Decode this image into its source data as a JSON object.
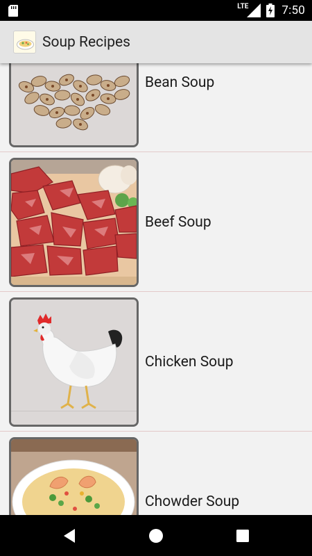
{
  "status_bar": {
    "time": "7:50",
    "network": "LTE",
    "icons": [
      "sd-card-icon",
      "signal-icon",
      "battery-charging-icon"
    ]
  },
  "app_bar": {
    "title": "Soup Recipes",
    "logo_icon": "soup-bowl-icon"
  },
  "recipes": [
    {
      "label": "Bean Soup",
      "image": "beans-image"
    },
    {
      "label": "Beef Soup",
      "image": "raw-beef-image"
    },
    {
      "label": "Chicken Soup",
      "image": "white-chicken-image"
    },
    {
      "label": "Chowder Soup",
      "image": "chowder-bowl-image"
    }
  ],
  "nav_bar": {
    "buttons": [
      "back-icon",
      "home-icon",
      "recents-icon"
    ]
  },
  "colors": {
    "status_bar": "#000000",
    "app_bar": "#e4e4e4",
    "list_background": "#f2f2f2",
    "divider": "#e3c9c9",
    "thumb_border": "#666666"
  }
}
